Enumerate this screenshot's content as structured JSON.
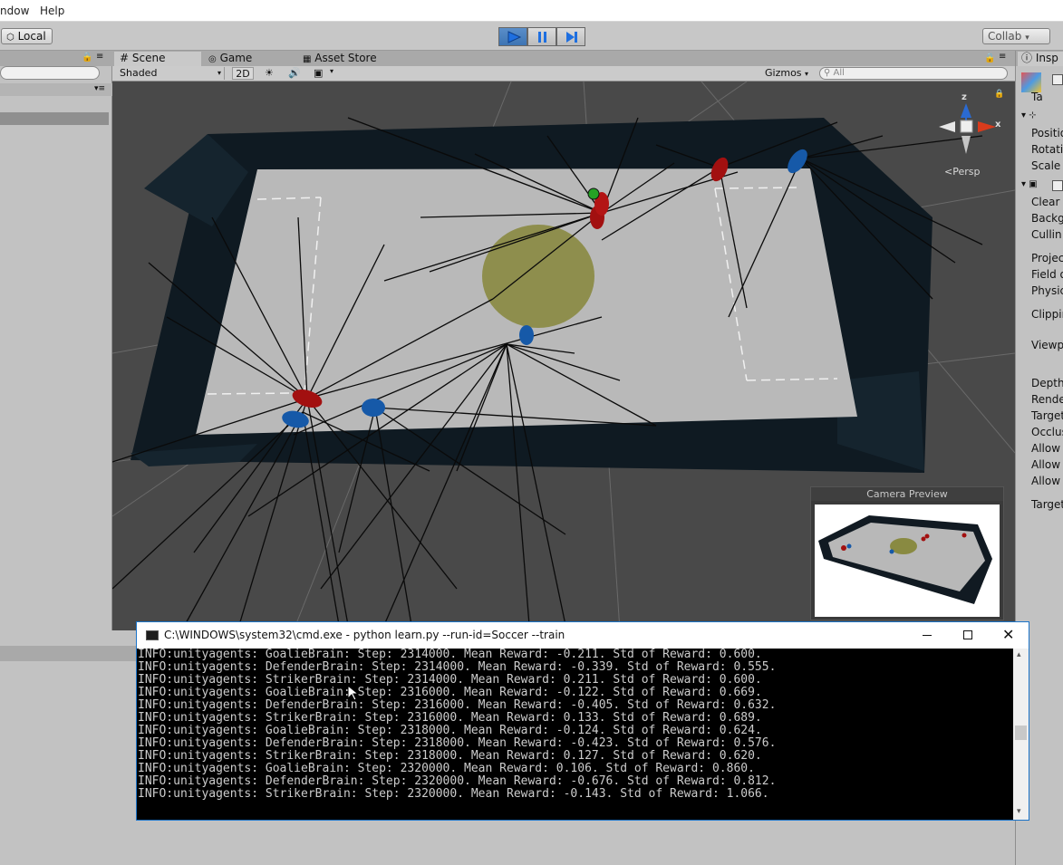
{
  "menu": {
    "window": "ndow",
    "help": "Help"
  },
  "toolbar": {
    "local_label": "Local",
    "collab_label": "Collab"
  },
  "tabs": {
    "scene": "Scene",
    "game": "Game",
    "asset_store": "Asset Store"
  },
  "scene_toolbar": {
    "shading": "Shaded",
    "mode_2d": "2D",
    "gizmos": "Gizmos",
    "search_placeholder": "All"
  },
  "gizmo": {
    "z": "z",
    "x": "x",
    "persp": "Persp"
  },
  "camera_preview": {
    "title": "Camera Preview"
  },
  "inspector": {
    "tab": "Insp",
    "tag": "Ta",
    "rows": [
      "Positio",
      "Rotatio",
      "Scale",
      "Clear",
      "Backg",
      "Cullin",
      "Projec",
      "Field o",
      "Physic",
      "Clippin",
      "Viewp",
      "Depth",
      "Rende",
      "Target",
      "Occlus",
      "Allow",
      "Allow",
      "Allow",
      "Target"
    ]
  },
  "cmd": {
    "title": "C:\\WINDOWS\\system32\\cmd.exe - python  learn.py --run-id=Soccer --train",
    "lines": [
      "INFO:unityagents: GoalieBrain: Step: 2314000. Mean Reward: -0.211. Std of Reward: 0.600.",
      "INFO:unityagents: DefenderBrain: Step: 2314000. Mean Reward: -0.339. Std of Reward: 0.555.",
      "INFO:unityagents: StrikerBrain: Step: 2314000. Mean Reward: 0.211. Std of Reward: 0.600.",
      "INFO:unityagents: GoalieBrain: Step: 2316000. Mean Reward: -0.122. Std of Reward: 0.669.",
      "INFO:unityagents: DefenderBrain: Step: 2316000. Mean Reward: -0.405. Std of Reward: 0.632.",
      "INFO:unityagents: StrikerBrain: Step: 2316000. Mean Reward: 0.133. Std of Reward: 0.689.",
      "INFO:unityagents: GoalieBrain: Step: 2318000. Mean Reward: -0.124. Std of Reward: 0.624.",
      "INFO:unityagents: DefenderBrain: Step: 2318000. Mean Reward: -0.423. Std of Reward: 0.576.",
      "INFO:unityagents: StrikerBrain: Step: 2318000. Mean Reward: 0.127. Std of Reward: 0.620.",
      "INFO:unityagents: GoalieBrain: Step: 2320000. Mean Reward: 0.106. Std of Reward: 0.860.",
      "INFO:unityagents: DefenderBrain: Step: 2320000. Mean Reward: -0.676. Std of Reward: 0.812.",
      "INFO:unityagents: StrikerBrain: Step: 2320000. Mean Reward: -0.143. Std of Reward: 1.066."
    ]
  }
}
